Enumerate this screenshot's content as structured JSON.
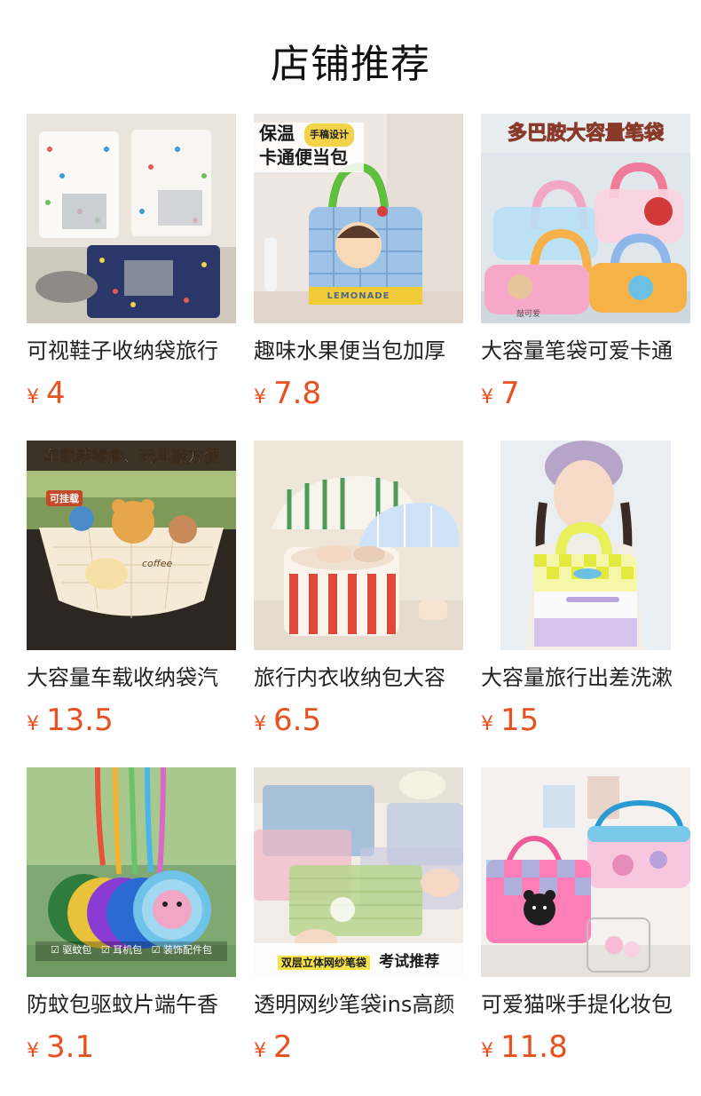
{
  "page": {
    "title": "店铺推荐"
  },
  "currency_symbol": "¥",
  "products": [
    {
      "name": "可视鞋子收纳袋旅行",
      "price": "4",
      "image_alt": "shoe-storage-bag-photo"
    },
    {
      "name": "趣味水果便当包加厚",
      "price": "7.8",
      "image_alt": "lunch-bag-photo",
      "image_texts": [
        "保温",
        "卡通便当包",
        "手稿设计",
        "LEMONADE"
      ]
    },
    {
      "name": "大容量笔袋可爱卡通",
      "price": "7",
      "image_alt": "pencil-case-photo",
      "image_texts": [
        "多巴胺大容量笔袋",
        "敲可爱"
      ]
    },
    {
      "name": "大容量车载收纳袋汽",
      "price": "13.5",
      "image_alt": "car-storage-bag-photo",
      "image_texts": [
        "车载装零食、玩具敲方便",
        "可挂载",
        "coffee"
      ]
    },
    {
      "name": "旅行内衣收纳包大容",
      "price": "6.5",
      "image_alt": "underwear-bag-photo"
    },
    {
      "name": "大容量旅行出差洗漱",
      "price": "15",
      "image_alt": "toiletry-bag-photo"
    },
    {
      "name": "防蚊包驱蚊片端午香",
      "price": "3.1",
      "image_alt": "mosquito-pouch-photo",
      "image_texts": [
        "驱蚊包",
        "耳机包",
        "装饰配件包"
      ]
    },
    {
      "name": "透明网纱笔袋ins高颜",
      "price": "2",
      "image_alt": "mesh-pencil-case-photo",
      "image_texts": [
        "双层立体网纱笔袋",
        "考试推荐"
      ]
    },
    {
      "name": "可爱猫咪手提化妆包",
      "price": "11.8",
      "image_alt": "cat-cosmetic-bag-photo"
    }
  ]
}
